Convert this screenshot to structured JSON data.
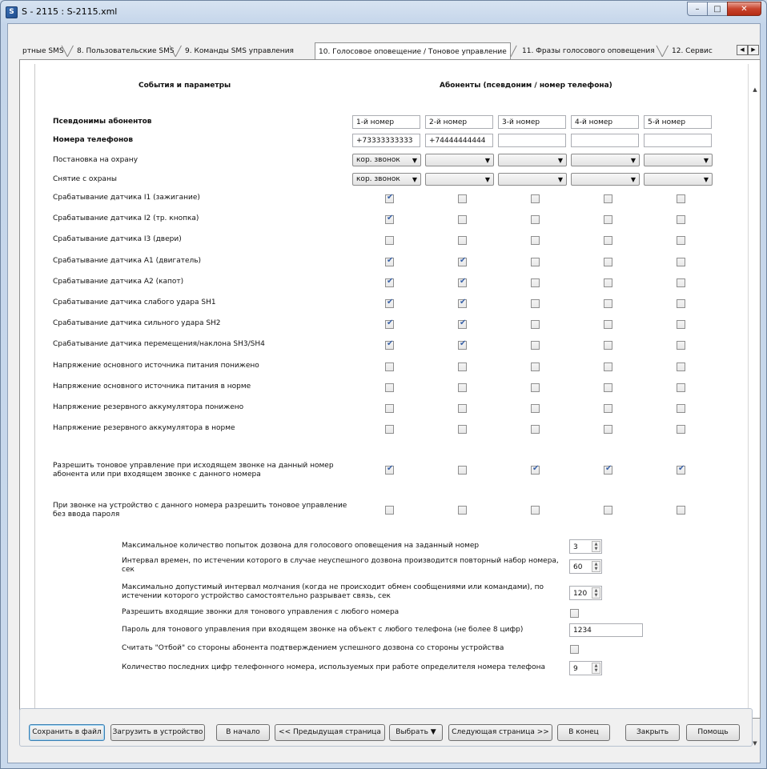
{
  "window": {
    "title": "S - 2115 : S-2115.xml",
    "icon": "app-icon"
  },
  "tabs": [
    {
      "label": "ртные SMS"
    },
    {
      "label": "8. Пользовательские SMS"
    },
    {
      "label": "9. Команды SMS управления"
    },
    {
      "label": "10. Голосовое оповещение / Тоновое управление",
      "active": true
    },
    {
      "label": "11. Фразы голосового оповещения"
    },
    {
      "label": "12. Сервис"
    }
  ],
  "table": {
    "header_left": "События и параметры",
    "header_right": "Абоненты (псевдоним / номер телефона)",
    "aliases_label": "Псевдонимы абонентов",
    "aliases": [
      "1-й номер",
      "2-й номер",
      "3-й номер",
      "4-й номер",
      "5-й номер"
    ],
    "phones_label": "Номера телефонов",
    "phones": [
      "+73333333333",
      "+74444444444",
      "",
      "",
      ""
    ],
    "combo_rows": [
      {
        "label": "Постановка на охрану",
        "values": [
          "кор. звонок",
          "",
          "",
          "",
          ""
        ]
      },
      {
        "label": "Снятие с охраны",
        "values": [
          "кор. звонок",
          "",
          "",
          "",
          ""
        ]
      }
    ],
    "check_rows": [
      {
        "label": "Срабатывание датчика I1 (зажигание)",
        "checks": [
          true,
          false,
          false,
          false,
          false
        ]
      },
      {
        "label": "Срабатывание датчика I2 (тр. кнопка)",
        "checks": [
          true,
          false,
          false,
          false,
          false
        ]
      },
      {
        "label": "Срабатывание датчика I3 (двери)",
        "checks": [
          false,
          false,
          false,
          false,
          false
        ]
      },
      {
        "label": "Срабатывание датчика A1 (двигатель)",
        "checks": [
          true,
          true,
          false,
          false,
          false
        ]
      },
      {
        "label": "Срабатывание датчика A2 (капот)",
        "checks": [
          true,
          true,
          false,
          false,
          false
        ]
      },
      {
        "label": "Срабатывание датчика слабого удара SH1",
        "checks": [
          true,
          true,
          false,
          false,
          false
        ]
      },
      {
        "label": "Срабатывание датчика сильного удара SH2",
        "checks": [
          true,
          true,
          false,
          false,
          false
        ]
      },
      {
        "label": "Срабатывание датчика перемещения/наклона SH3/SH4",
        "checks": [
          true,
          true,
          false,
          false,
          false
        ]
      },
      {
        "label": "Напряжение основного источника питания понижено",
        "checks": [
          false,
          false,
          false,
          false,
          false
        ]
      },
      {
        "label": "Напряжение основного источника питания в норме",
        "checks": [
          false,
          false,
          false,
          false,
          false
        ]
      },
      {
        "label": "Напряжение резервного аккумулятора понижено",
        "checks": [
          false,
          false,
          false,
          false,
          false
        ]
      },
      {
        "label": "Напряжение резервного аккумулятора в норме",
        "checks": [
          false,
          false,
          false,
          false,
          false
        ]
      }
    ],
    "tone_rows": [
      {
        "line1": "Разрешить тоновое управление при исходящем звонке на данный номер",
        "line2": "абонента или при входящем звонке с данного номера",
        "checks": [
          true,
          false,
          true,
          true,
          true
        ]
      },
      {
        "line1": "При звонке на устройство с данного номера разрешить тоновое управление",
        "line2": "без ввода пароля",
        "checks": [
          false,
          false,
          false,
          false,
          false
        ]
      }
    ]
  },
  "settings": [
    {
      "line1": "Максимальное количество попыток дозвона для голосового оповещения на заданный номер",
      "line2": "",
      "type": "spin",
      "value": "3"
    },
    {
      "line1": "Интервал времен, по истечении которого в случае неуспешного дозвона производится повторный набор номера,",
      "line2": "сек",
      "type": "spin",
      "value": "60"
    },
    {
      "line1": "Максимально допустимый интервал молчания (когда не происходит обмен сообщениями или командами), по",
      "line2": "истечении которого устройство самостоятельно разрывает связь, сек",
      "type": "spin",
      "value": "120"
    },
    {
      "line1": "Разрешить входящие звонки для тонового управления с любого номера",
      "line2": "",
      "type": "check",
      "checked": false
    },
    {
      "line1": "Пароль для тонового управления при входящем звонке на объект с любого телефона (не более 8 цифр)",
      "line2": "",
      "type": "text",
      "value": "1234"
    },
    {
      "line1": "Считать \"Отбой\" со стороны абонента подтверждением успешного дозвона со стороны устройства",
      "line2": "",
      "type": "check",
      "checked": false
    },
    {
      "line1": "Количество последних цифр телефонного номера, используемых при работе определителя номера телефона",
      "line2": "",
      "type": "spin",
      "value": "9"
    }
  ],
  "buttons": {
    "save": "Сохранить в файл",
    "upload": "Загрузить в устройство",
    "first": "В начало",
    "prev": "<< Предыдущая страница",
    "select": "Выбрать",
    "next": "Следующая страница >>",
    "last": "В конец",
    "close": "Закрыть",
    "help": "Помощь"
  },
  "colors": {
    "accent": "#3b63a8",
    "window_frame": "#c4d5ea",
    "close_button": "#c8432c"
  }
}
